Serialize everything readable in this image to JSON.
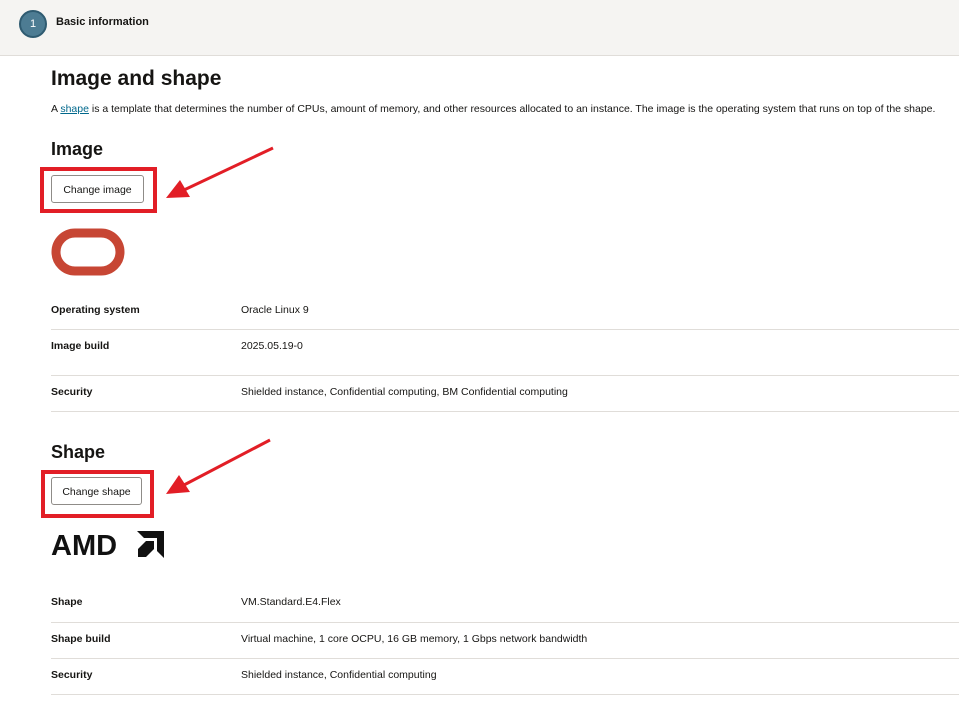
{
  "step": {
    "number": "1",
    "label": "Basic information"
  },
  "section": {
    "title": "Image and shape",
    "intro_prefix": "A ",
    "intro_link": "shape",
    "intro_suffix": " is a template that determines the number of CPUs, amount of memory, and other resources allocated to an instance. The image is the operating system that runs on top of the shape."
  },
  "image": {
    "heading": "Image",
    "button_label": "Change image",
    "logo": "oracle-logo",
    "details": [
      {
        "label": "Operating system",
        "value": "Oracle Linux 9"
      },
      {
        "label": "Image build",
        "value": "2025.05.19-0"
      },
      {
        "label": "Security",
        "value": "Shielded instance, Confidential computing, BM Confidential computing"
      }
    ]
  },
  "shape": {
    "heading": "Shape",
    "button_label": "Change shape",
    "logo": "amd-logo",
    "details": [
      {
        "label": "Shape",
        "value": "VM.Standard.E4.Flex"
      },
      {
        "label": "Shape build",
        "value": "Virtual machine, 1 core OCPU, 16 GB memory, 1 Gbps network bandwidth"
      },
      {
        "label": "Security",
        "value": "Shielded instance, Confidential computing"
      }
    ]
  },
  "colors": {
    "highlight": "#e21e26",
    "oracle_red": "#c74634",
    "link": "#00688c",
    "step_circle": "#4d7c93"
  }
}
